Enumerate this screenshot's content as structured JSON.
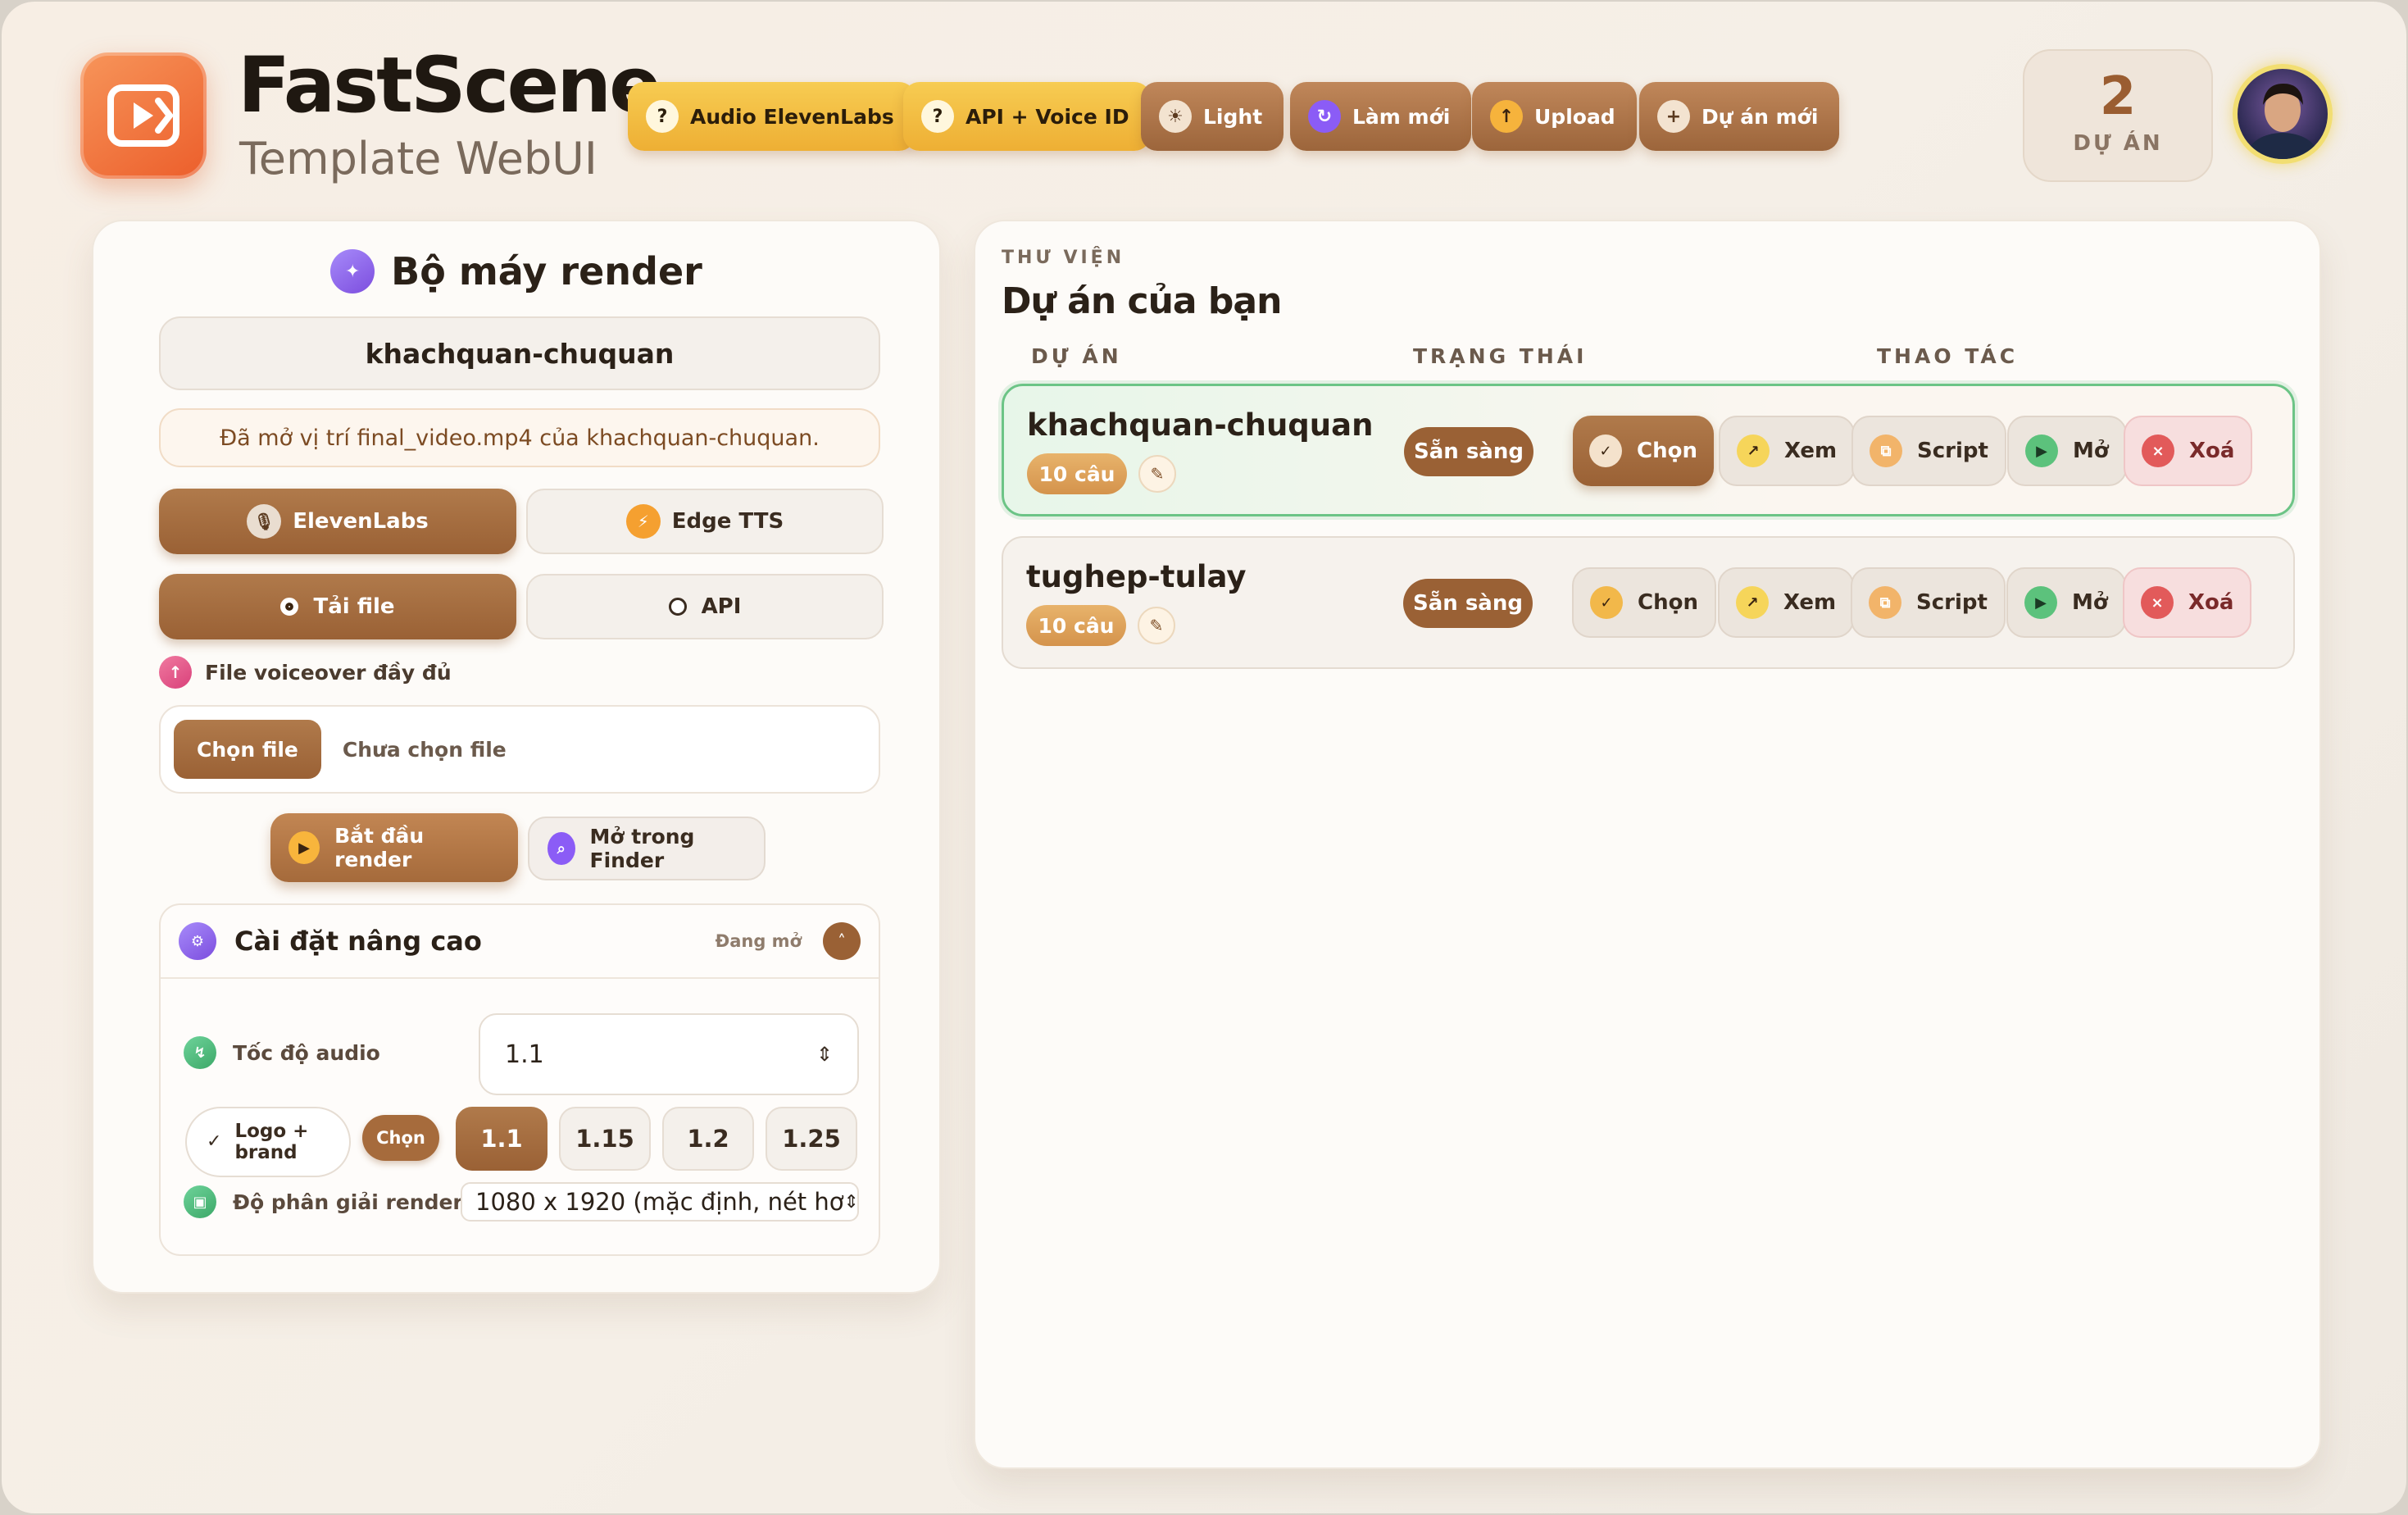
{
  "app": {
    "title": "FastScene",
    "subtitle": "Template WebUI"
  },
  "toolbar": [
    {
      "label": "Audio ElevenLabs",
      "icon": "help-icon",
      "glyph": "?"
    },
    {
      "label": "API + Voice ID",
      "icon": "help-icon",
      "glyph": "?"
    },
    {
      "label": "Light",
      "icon": "sun-icon",
      "glyph": "☀"
    },
    {
      "label": "Làm mới",
      "icon": "refresh-icon",
      "glyph": "↻"
    },
    {
      "label": "Upload",
      "icon": "upload-icon",
      "glyph": "↑"
    },
    {
      "label": "Dự án mới",
      "icon": "plus-icon",
      "glyph": "+"
    }
  ],
  "project_count": {
    "value": "2",
    "label": "DỰ ÁN"
  },
  "render": {
    "title": "Bộ máy render",
    "project_name": "khachquan-chuquan",
    "notice": "Đã mở vị trí final_video.mp4 của khachquan-chuquan.",
    "tts": {
      "eleven": "ElevenLabs",
      "edge": "Edge TTS"
    },
    "source": {
      "file": "Tải file",
      "api": "API"
    },
    "voiceover_label": "File voiceover đầy đủ",
    "file_button": "Chọn file",
    "file_status": "Chưa chọn file",
    "start_button": "Bắt đầu render",
    "finder_button": "Mở trong Finder",
    "advanced": {
      "title": "Cài đặt nâng cao",
      "state": "Đang mở",
      "speed_label": "Tốc độ audio",
      "speed_value": "1.1",
      "logo_label": "Logo + brand",
      "logo_button": "Chọn",
      "speed_chips": [
        "1.1",
        "1.15",
        "1.2",
        "1.25"
      ],
      "speed_selected": "1.1",
      "resolution_label": "Độ phân giải render",
      "resolution_value": "1080 x 1920 (mặc định, nét hơ"
    }
  },
  "library": {
    "section": "THƯ VIỆN",
    "title": "Dự án của bạn",
    "columns": [
      "DỰ ÁN",
      "TRẠNG THÁI",
      "THAO TÁC"
    ],
    "actions": {
      "select": "Chọn",
      "view": "Xem",
      "script": "Script",
      "open": "Mở",
      "delete": "Xoá"
    },
    "projects": [
      {
        "name": "khachquan-chuquan",
        "count": "10 câu",
        "status": "Sẵn sàng",
        "active": true
      },
      {
        "name": "tughep-tulay",
        "count": "10 câu",
        "status": "Sẵn sàng",
        "active": false
      }
    ]
  },
  "colors": {
    "accent": "#9a6135",
    "gold": "#eeaf34",
    "success": "#6cc486",
    "danger": "#e25a5a",
    "brand": "#ec5e2b"
  }
}
